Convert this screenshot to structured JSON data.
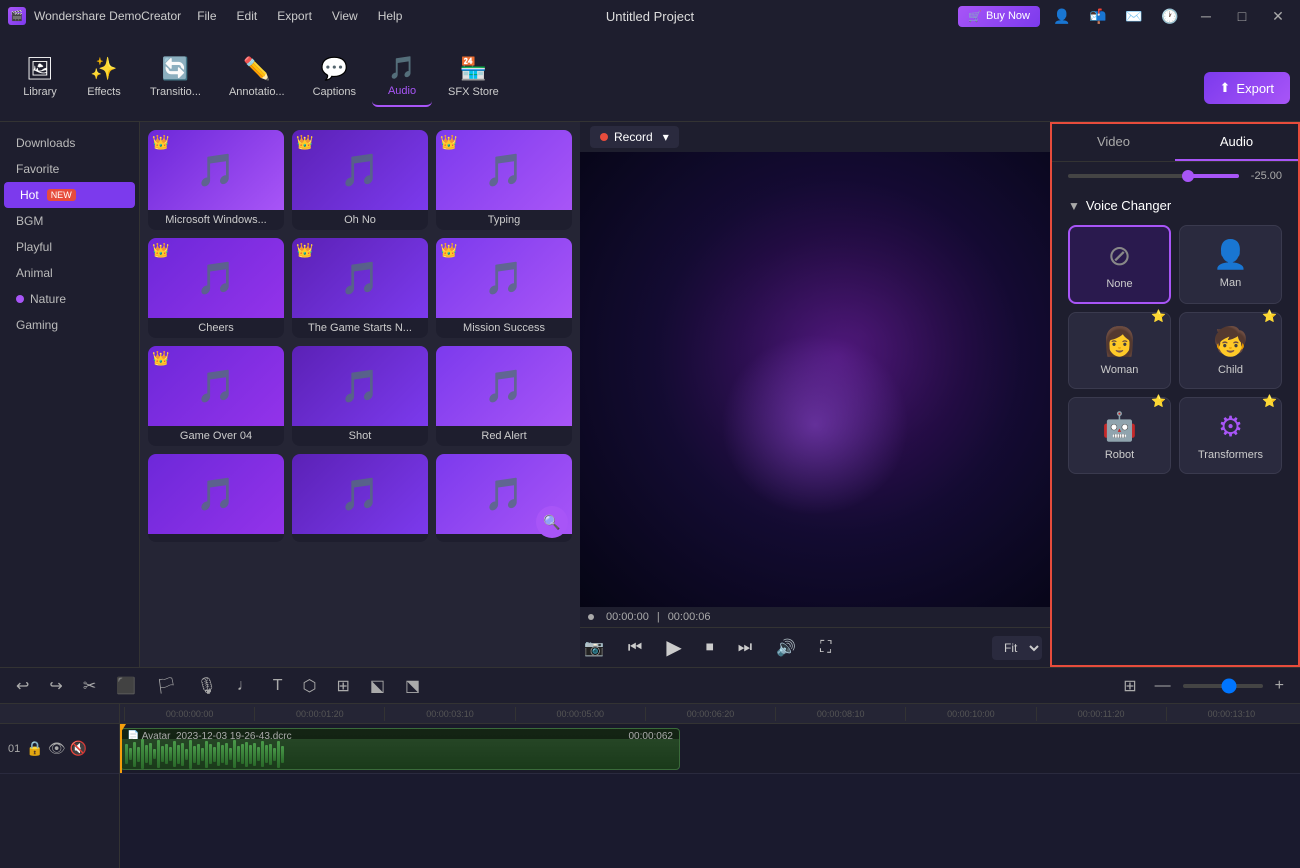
{
  "titlebar": {
    "app_name": "Wondershare DemoCreator",
    "project_title": "Untitled Project",
    "menu_items": [
      "File",
      "Edit",
      "Export",
      "View",
      "Help"
    ],
    "buy_now_label": "Buy Now",
    "window_controls": [
      "minimize",
      "maximize",
      "close"
    ]
  },
  "toolbar": {
    "items": [
      {
        "id": "library",
        "label": "Library",
        "icon": "🖼"
      },
      {
        "id": "effects",
        "label": "Effects",
        "icon": "✨"
      },
      {
        "id": "transitions",
        "label": "Transitio...",
        "icon": "🔄"
      },
      {
        "id": "annotations",
        "label": "Annotatio...",
        "icon": "✏️"
      },
      {
        "id": "captions",
        "label": "Captions",
        "icon": "💬"
      },
      {
        "id": "audio",
        "label": "Audio",
        "icon": "🎵"
      },
      {
        "id": "sfxstore",
        "label": "SFX Store",
        "icon": "🏪"
      }
    ],
    "expand_icon": "›"
  },
  "sidebar": {
    "items": [
      {
        "id": "downloads",
        "label": "Downloads",
        "active": false
      },
      {
        "id": "favorite",
        "label": "Favorite",
        "active": false
      },
      {
        "id": "hot",
        "label": "Hot",
        "active": true,
        "badge": "NEW"
      },
      {
        "id": "bgm",
        "label": "BGM",
        "active": false
      },
      {
        "id": "playful",
        "label": "Playful",
        "active": false
      },
      {
        "id": "animal",
        "label": "Animal",
        "active": false
      },
      {
        "id": "nature",
        "label": "Nature",
        "active": false,
        "dot": true
      },
      {
        "id": "gaming",
        "label": "Gaming",
        "active": false
      }
    ]
  },
  "audio_items": [
    {
      "id": "1",
      "label": "Microsoft Windows...",
      "crown": true,
      "color1": "#6d28d9",
      "color2": "#a855f7"
    },
    {
      "id": "2",
      "label": "Oh No",
      "crown": true,
      "color1": "#5b21b6",
      "color2": "#7c3aed"
    },
    {
      "id": "3",
      "label": "Typing",
      "crown": true,
      "color1": "#7c3aed",
      "color2": "#a855f7"
    },
    {
      "id": "4",
      "label": "Cheers",
      "crown": true,
      "color1": "#6d28d9",
      "color2": "#9333ea"
    },
    {
      "id": "5",
      "label": "The Game Starts N...",
      "crown": true,
      "color1": "#5b21b6",
      "color2": "#7c3aed"
    },
    {
      "id": "6",
      "label": "Mission Success",
      "crown": true,
      "color1": "#7c3aed",
      "color2": "#a855f7"
    },
    {
      "id": "7",
      "label": "Game Over 04",
      "crown": true,
      "color1": "#6d28d9",
      "color2": "#9333ea"
    },
    {
      "id": "8",
      "label": "Shot",
      "crown": false,
      "color1": "#5b21b6",
      "color2": "#7c3aed"
    },
    {
      "id": "9",
      "label": "Red Alert",
      "crown": false,
      "color1": "#7c3aed",
      "color2": "#a855f7"
    },
    {
      "id": "10",
      "label": "",
      "crown": false,
      "color1": "#6d28d9",
      "color2": "#9333ea",
      "last_row": true
    },
    {
      "id": "11",
      "label": "",
      "crown": false,
      "color1": "#5b21b6",
      "color2": "#7c3aed",
      "last_row": true
    },
    {
      "id": "12",
      "label": "",
      "crown": false,
      "color1": "#7c3aed",
      "color2": "#a855f7",
      "last_row": true,
      "search": true
    }
  ],
  "preview": {
    "record_label": "Record",
    "time_current": "00:00:00",
    "time_total": "00:00:06",
    "fit_label": "Fit"
  },
  "right_panel": {
    "tabs": [
      "Video",
      "Audio"
    ],
    "active_tab": "Audio",
    "slider_value": "-25.00",
    "voice_changer_title": "Voice Changer",
    "voices": [
      {
        "id": "none",
        "label": "None",
        "icon": "⊘",
        "premium": false,
        "selected": true
      },
      {
        "id": "man",
        "label": "Man",
        "icon": "👤",
        "premium": false,
        "selected": false
      },
      {
        "id": "woman",
        "label": "Woman",
        "icon": "👤",
        "premium": true,
        "selected": false
      },
      {
        "id": "child",
        "label": "Child",
        "icon": "👶",
        "premium": true,
        "selected": false
      },
      {
        "id": "robot",
        "label": "Robot",
        "icon": "🤖",
        "premium": true,
        "selected": false
      },
      {
        "id": "transformers",
        "label": "Transformers",
        "icon": "⚙",
        "premium": true,
        "selected": false
      }
    ]
  },
  "export_btn": "Export",
  "timeline": {
    "toolbar_buttons": [
      "undo",
      "redo",
      "split",
      "trim",
      "marker",
      "record-audio",
      "beat",
      "text",
      "motion",
      "crop",
      "group",
      "ungroup"
    ],
    "ruler_marks": [
      "00:00:00:00",
      "00:00:01:20",
      "00:00:03:10",
      "00:00:05:00",
      "00:00:06:20",
      "00:00:08:10",
      "00:00:10:00",
      "00:00:11:20",
      "00:00:13:10"
    ],
    "clip_filename": "Avatar_2023-12-03 19-26-43.dcrc",
    "clip_duration": "00:00:062",
    "track_row_number": "01"
  }
}
